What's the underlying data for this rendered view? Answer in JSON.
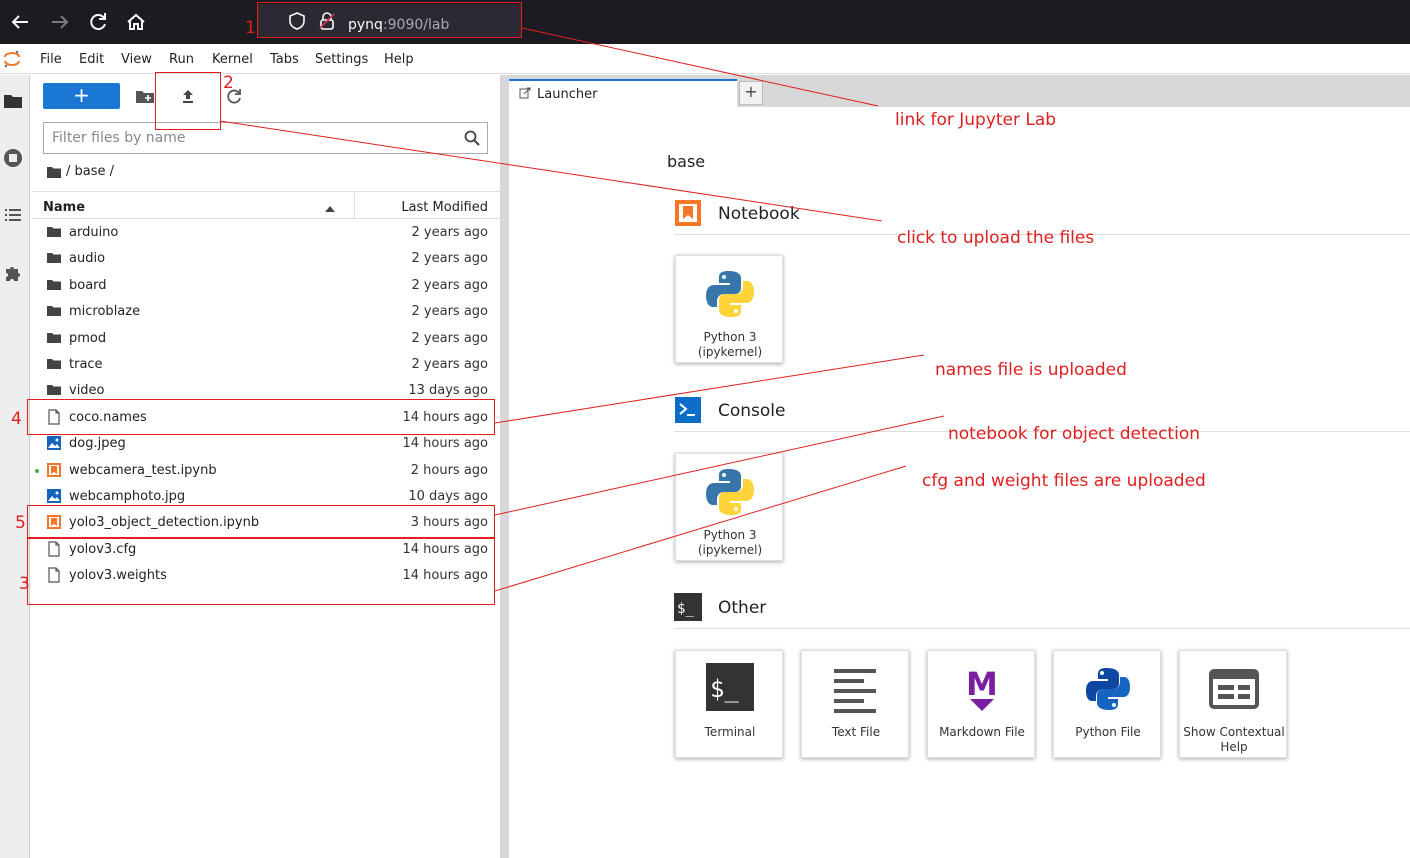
{
  "browser": {
    "url_host": "pynq",
    "url_rest": ":9090/lab",
    "icons": [
      "back-arrow-icon",
      "forward-arrow-icon",
      "reload-icon",
      "home-icon",
      "shield-icon",
      "lock-icon"
    ]
  },
  "menu": {
    "items": [
      "File",
      "Edit",
      "View",
      "Run",
      "Kernel",
      "Tabs",
      "Settings",
      "Help"
    ]
  },
  "filebrowser": {
    "new_button_label": "+",
    "filter_placeholder": "Filter files by name",
    "breadcrumb": "/ base /",
    "col_name": "Name",
    "col_modified": "Last Modified",
    "files": [
      {
        "name": "arduino",
        "modified": "2 years ago",
        "type": "folder"
      },
      {
        "name": "audio",
        "modified": "2 years ago",
        "type": "folder"
      },
      {
        "name": "board",
        "modified": "2 years ago",
        "type": "folder"
      },
      {
        "name": "microblaze",
        "modified": "2 years ago",
        "type": "folder"
      },
      {
        "name": "pmod",
        "modified": "2 years ago",
        "type": "folder"
      },
      {
        "name": "trace",
        "modified": "2 years ago",
        "type": "folder"
      },
      {
        "name": "video",
        "modified": "13 days ago",
        "type": "folder"
      },
      {
        "name": "coco.names",
        "modified": "14 hours ago",
        "type": "file"
      },
      {
        "name": "dog.jpeg",
        "modified": "14 hours ago",
        "type": "image"
      },
      {
        "name": "webcamera_test.ipynb",
        "modified": "2 hours ago",
        "type": "notebook",
        "running": true
      },
      {
        "name": "webcamphoto.jpg",
        "modified": "10 days ago",
        "type": "image"
      },
      {
        "name": "yolo3_object_detection.ipynb",
        "modified": "3 hours ago",
        "type": "notebook"
      },
      {
        "name": "yolov3.cfg",
        "modified": "14 hours ago",
        "type": "file"
      },
      {
        "name": "yolov3.weights",
        "modified": "14 hours ago",
        "type": "file"
      }
    ]
  },
  "launcher": {
    "tab_label": "Launcher",
    "add_tab": "+",
    "cwd": "base",
    "sections": {
      "notebook": {
        "title": "Notebook",
        "cards": [
          {
            "line1": "Python 3",
            "line2": "(ipykernel)"
          }
        ]
      },
      "console": {
        "title": "Console",
        "cards": [
          {
            "line1": "Python 3",
            "line2": "(ipykernel)"
          }
        ]
      },
      "other": {
        "title": "Other",
        "cards": [
          {
            "line1": "Terminal",
            "line2": ""
          },
          {
            "line1": "Text File",
            "line2": ""
          },
          {
            "line1": "Markdown File",
            "line2": ""
          },
          {
            "line1": "Python File",
            "line2": ""
          },
          {
            "line1": "Show Contextual",
            "line2": "Help"
          }
        ]
      }
    }
  },
  "annotations": {
    "numbers": [
      "1",
      "2",
      "3",
      "4",
      "5"
    ],
    "link_label": "link for Jupyter Lab",
    "upload_label": "click to upload the files",
    "names_label": "names file is uploaded",
    "notebook_label": "notebook for object detection",
    "cfg_label": "cfg and weight files are uploaded",
    "color": "#e02020"
  },
  "colors": {
    "accent": "#1976d2",
    "notebook_orange": "#f37726",
    "console_blue": "#0d6ec9",
    "markdown_purple": "#7b1fa2"
  }
}
